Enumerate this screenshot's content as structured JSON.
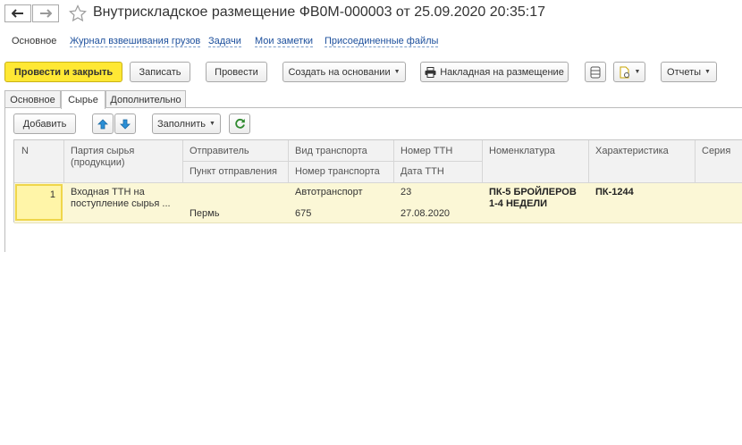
{
  "window": {
    "title": "Внутрискладское размещение ФВ0М-000003 от 25.09.2020 20:35:17"
  },
  "sections": [
    {
      "label": "Основное"
    },
    {
      "label": "Журнал взвешивания грузов"
    },
    {
      "label": "Задачи"
    },
    {
      "label": "Мои заметки"
    },
    {
      "label": "Присоединенные файлы"
    }
  ],
  "toolbar": {
    "post_close": "Провести и закрыть",
    "save": "Записать",
    "post": "Провести",
    "create_based": "Создать на основании",
    "placement_invoice": "Накладная на размещение",
    "reports": "Отчеты"
  },
  "tabs": [
    {
      "label": "Основное"
    },
    {
      "label": "Сырье"
    },
    {
      "label": "Дополнительно"
    }
  ],
  "table_toolbar": {
    "add": "Добавить",
    "fill": "Заполнить"
  },
  "table": {
    "headers": {
      "n": "N",
      "batch": "Партия сырья (продукции)",
      "sender": "Отправитель",
      "dispatch_point": "Пункт отправления",
      "transport_type": "Вид транспорта",
      "transport_number": "Номер транспорта",
      "ttn_number": "Номер ТТН",
      "ttn_date": "Дата ТТН",
      "nomenclature": "Номенклатура",
      "characteristic": "Характеристика",
      "series": "Серия"
    },
    "rows": [
      {
        "n": "1",
        "batch": "Входная ТТН на поступление сырья  ...",
        "sender": "",
        "dispatch_point": "Пермь",
        "transport_type": "Автотранспорт",
        "transport_number": "675",
        "ttn_number": "23",
        "ttn_date": "27.08.2020",
        "nomenclature": "ПК-5 БРОЙЛЕРОВ 1-4 НЕДЕЛИ",
        "characteristic": "ПК-1244",
        "series": ""
      }
    ]
  },
  "colors": {
    "primary_button": "#ffe834",
    "selected_row": "#fbf7d6",
    "link": "#1c4f9c"
  }
}
